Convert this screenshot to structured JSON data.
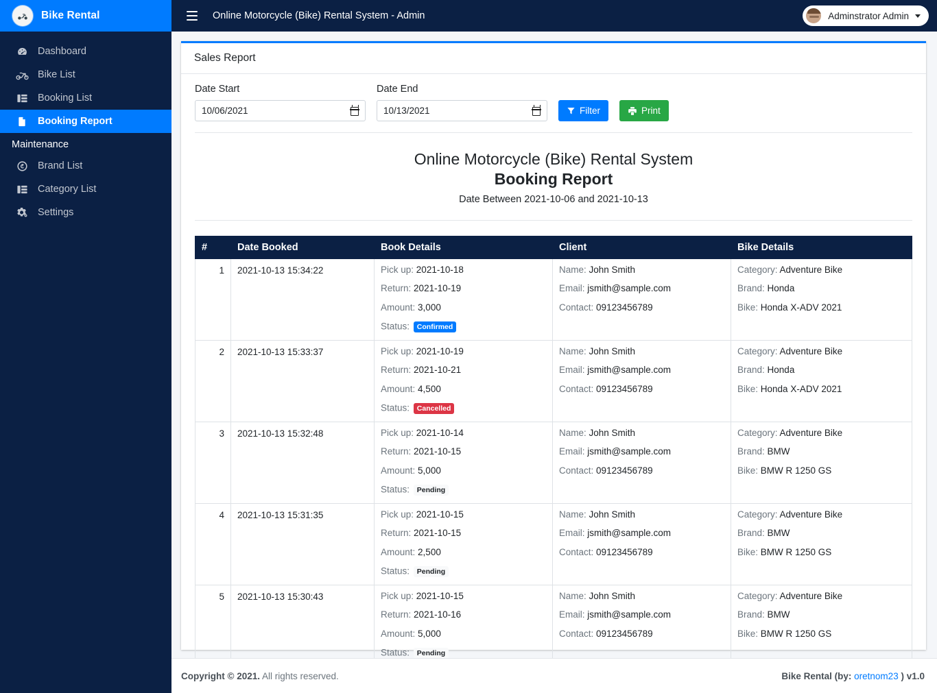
{
  "sidebar": {
    "brand": {
      "title": "Bike Rental",
      "logo_icon": "motorcycle-logo-icon"
    },
    "items": [
      {
        "label": "Dashboard",
        "icon": "dashboard-gauge-icon",
        "active": false
      },
      {
        "label": "Bike List",
        "icon": "motorcycle-icon",
        "active": false
      },
      {
        "label": "Booking List",
        "icon": "table-list-icon",
        "active": false
      },
      {
        "label": "Booking Report",
        "icon": "file-document-icon",
        "active": true
      }
    ],
    "section_header": "Maintenance",
    "maintenance_items": [
      {
        "label": "Brand List",
        "icon": "copyright-circle-icon"
      },
      {
        "label": "Category List",
        "icon": "table-list-icon"
      },
      {
        "label": "Settings",
        "icon": "gears-icon"
      }
    ]
  },
  "topbar": {
    "menu_icon": "hamburger-menu-icon",
    "title": "Online Motorcycle (Bike) Rental System - Admin",
    "user_name": "Adminstrator Admin",
    "avatar_icon": "user-avatar-icon",
    "caret_icon": "chevron-down-icon"
  },
  "card": {
    "header_title": "Sales Report"
  },
  "filters": {
    "date_start": {
      "label": "Date Start",
      "value": "10/06/2021",
      "placeholder": "mm/dd/yyyy",
      "icon": "calendar-icon"
    },
    "date_end": {
      "label": "Date End",
      "value": "10/13/2021",
      "placeholder": "mm/dd/yyyy",
      "icon": "calendar-icon"
    },
    "filter_button": {
      "label": "Filter",
      "icon": "funnel-filter-icon",
      "color": "#007bff"
    },
    "print_button": {
      "label": "Print",
      "icon": "printer-icon",
      "color": "#28a745"
    }
  },
  "report": {
    "system_name": "Online Motorcycle (Bike) Rental System",
    "title": "Booking Report",
    "date_range": "Date Between 2021-10-06 and 2021-10-13"
  },
  "table": {
    "columns": [
      "#",
      "Date Booked",
      "Book Details",
      "Client",
      "Bike Details"
    ],
    "labels": {
      "pickup": "Pick up:",
      "return": "Return:",
      "amount": "Amount:",
      "status": "Status:",
      "name": "Name:",
      "email": "Email:",
      "contact": "Contact:",
      "category": "Category:",
      "brand": "Brand:",
      "bike": "Bike:"
    },
    "rows": [
      {
        "num": "1",
        "date_booked": "2021-10-13 15:34:22",
        "pickup": "2021-10-18",
        "return": "2021-10-19",
        "amount": "3,000",
        "status": "Confirmed",
        "status_type": "confirmed",
        "name": "John Smith",
        "email": "jsmith@sample.com",
        "contact": "09123456789",
        "category": "Adventure Bike",
        "brand": "Honda",
        "bike": "Honda X-ADV 2021"
      },
      {
        "num": "2",
        "date_booked": "2021-10-13 15:33:37",
        "pickup": "2021-10-19",
        "return": "2021-10-21",
        "amount": "4,500",
        "status": "Cancelled",
        "status_type": "cancelled",
        "name": "John Smith",
        "email": "jsmith@sample.com",
        "contact": "09123456789",
        "category": "Adventure Bike",
        "brand": "Honda",
        "bike": "Honda X-ADV 2021"
      },
      {
        "num": "3",
        "date_booked": "2021-10-13 15:32:48",
        "pickup": "2021-10-14",
        "return": "2021-10-15",
        "amount": "5,000",
        "status": "Pending",
        "status_type": "pending",
        "name": "John Smith",
        "email": "jsmith@sample.com",
        "contact": "09123456789",
        "category": "Adventure Bike",
        "brand": "BMW",
        "bike": "BMW R 1250 GS"
      },
      {
        "num": "4",
        "date_booked": "2021-10-13 15:31:35",
        "pickup": "2021-10-15",
        "return": "2021-10-15",
        "amount": "2,500",
        "status": "Pending",
        "status_type": "pending",
        "name": "John Smith",
        "email": "jsmith@sample.com",
        "contact": "09123456789",
        "category": "Adventure Bike",
        "brand": "BMW",
        "bike": "BMW R 1250 GS"
      },
      {
        "num": "5",
        "date_booked": "2021-10-13 15:30:43",
        "pickup": "2021-10-15",
        "return": "2021-10-16",
        "amount": "5,000",
        "status": "Pending",
        "status_type": "pending",
        "name": "John Smith",
        "email": "jsmith@sample.com",
        "contact": "09123456789",
        "category": "Adventure Bike",
        "brand": "BMW",
        "bike": "BMW R 1250 GS"
      }
    ]
  },
  "footer": {
    "copyright_bold": "Copyright © 2021.",
    "copyright_rest": "All rights reserved.",
    "right_prefix": "Bike Rental (by:",
    "right_link": "oretnom23",
    "right_suffix": ") v1.0"
  },
  "colors": {
    "accent": "#007bff",
    "sidebar": "#0b2044",
    "success": "#28a745",
    "danger": "#dc3545"
  }
}
